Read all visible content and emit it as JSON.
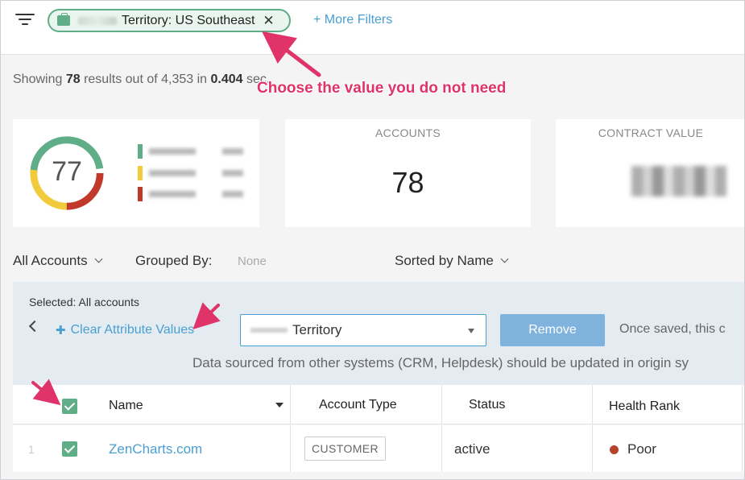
{
  "filter_bar": {
    "chip_text": "Territory: US Southeast",
    "chip_close": "✕",
    "more_filters": "+ More Filters"
  },
  "summary": {
    "showing_prefix": "Showing",
    "count": "78",
    "mid": "results out of 4,353 in",
    "time": "0.404",
    "suffix": "sec."
  },
  "annotation": {
    "callout": "Choose the value you do not need"
  },
  "cards": {
    "health_score": "77",
    "health_colors": [
      "#5fae88",
      "#f2cb3c",
      "#c0392b"
    ],
    "accounts_label": "ACCOUNTS",
    "accounts_value": "78",
    "contract_label": "CONTRACT VALUE"
  },
  "controls": {
    "view": "All Accounts",
    "grouped_label": "Grouped By:",
    "grouped_value": "None",
    "sorted": "Sorted by Name"
  },
  "panel": {
    "selected": "Selected: All accounts",
    "clear_attr": "Clear Attribute Values",
    "select_value": "Territory",
    "remove": "Remove",
    "once_saved": "Once saved, this c",
    "data_sourced": "Data sourced from other systems (CRM, Helpdesk) should be updated in origin sy"
  },
  "table": {
    "headers": [
      "Name",
      "Account Type",
      "Status",
      "Health Rank"
    ],
    "rows": [
      {
        "num": "1",
        "name": "ZenCharts.com",
        "account_type": "CUSTOMER",
        "status": "active",
        "health_rank": "Poor"
      }
    ]
  }
}
